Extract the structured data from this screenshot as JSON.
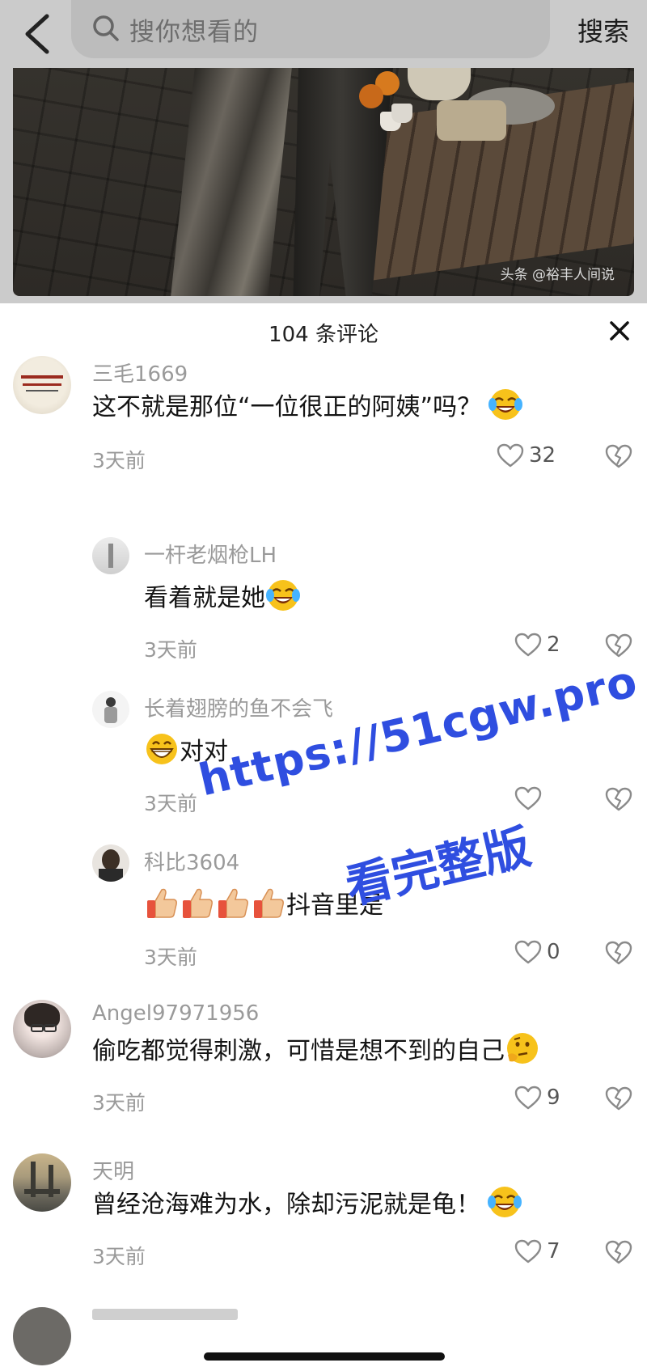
{
  "header": {
    "search_placeholder": "搜你想看的",
    "search_button": "搜索"
  },
  "photo": {
    "watermark": "头条 @裕丰人间说"
  },
  "comments_panel": {
    "title": "104 条评论"
  },
  "comments": [
    {
      "user": "三毛1669",
      "text": "这不就是那位“一位很正的阿姨”吗？",
      "emoji": "crying-laughing",
      "time": "3天前",
      "likes": "32"
    },
    {
      "user": "一杆老烟枪LH",
      "text": "看着就是她",
      "emoji": "crying-laughing",
      "time": "3天前",
      "likes": "2"
    },
    {
      "user": "长着翅膀的鱼不会飞",
      "text": "对对",
      "emoji": "grinning",
      "time": "3天前",
      "likes": ""
    },
    {
      "user": "科比3604",
      "text": "抖音里是",
      "emoji": "thumbs-up x4",
      "time": "3天前",
      "likes": "0"
    },
    {
      "user": "Angel97971956",
      "text": "偷吃都觉得刺激，可惜是想不到的自己",
      "emoji": "thinking",
      "time": "3天前",
      "likes": "9"
    },
    {
      "user": "天明",
      "text": "曾经沧海难为水，除却污泥就是龟！",
      "emoji": "crying-laughing",
      "time": "3天前",
      "likes": "7"
    }
  ],
  "overlay": {
    "url": "https://51cgw.pro",
    "sub": "看完整版"
  },
  "colors": {
    "overlay_blue": "#2f4ee0",
    "meta_gray": "#9a9a9a"
  }
}
